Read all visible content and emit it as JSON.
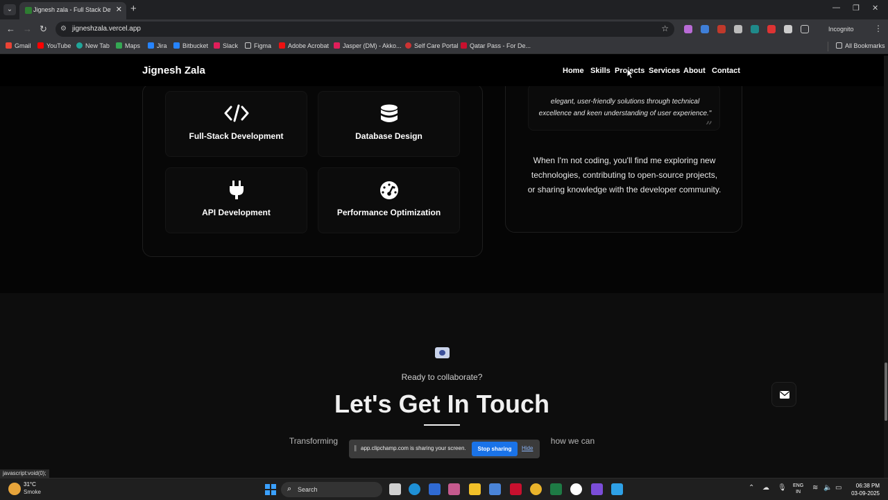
{
  "browser": {
    "tab_title": "Jignesh zala - Full Stack Developer",
    "url": "jigneshzala.vercel.app",
    "profile": "Incognito",
    "all_bookmarks": "All Bookmarks",
    "bookmarks": [
      "Gmail",
      "YouTube",
      "New Tab",
      "Maps",
      "Jira",
      "Bitbucket",
      "Slack",
      "Figma",
      "Adobe Acrobat",
      "Jasper (DM) - Akko...",
      "Self Care Portal",
      "Qatar Pass - For De..."
    ]
  },
  "site": {
    "brand": "Jignesh Zala",
    "nav": [
      "Home",
      "Skills",
      "Projects",
      "Services",
      "About",
      "Contact"
    ]
  },
  "skills": [
    {
      "label": "Full-Stack Development",
      "icon": "code-icon"
    },
    {
      "label": "Database Design",
      "icon": "database-icon"
    },
    {
      "label": "API Development",
      "icon": "plug-icon"
    },
    {
      "label": "Performance Optimization",
      "icon": "gauge-icon"
    }
  ],
  "about": {
    "quote": "elegant, user-friendly solutions through technical excellence and keen understanding of user experience.\"",
    "text": "When I'm not coding, you'll find me exploring new technologies, contributing to open-source projects, or sharing knowledge with the developer community."
  },
  "contact": {
    "kicker": "Ready to collaborate?",
    "headline": "Let's Get In Touch",
    "sub_left": "Transforming",
    "sub_right": "how we can"
  },
  "share_bar": {
    "message": "app.clipchamp.com is sharing your screen.",
    "stop": "Stop sharing",
    "hide": "Hide"
  },
  "status_url": "javascript:void(0);",
  "taskbar": {
    "temp": "31°C",
    "condition": "Smoke",
    "search": "Search",
    "lang_top": "ENG",
    "lang_bottom": "IN",
    "time": "06:38 PM",
    "date": "03-09-2025"
  }
}
